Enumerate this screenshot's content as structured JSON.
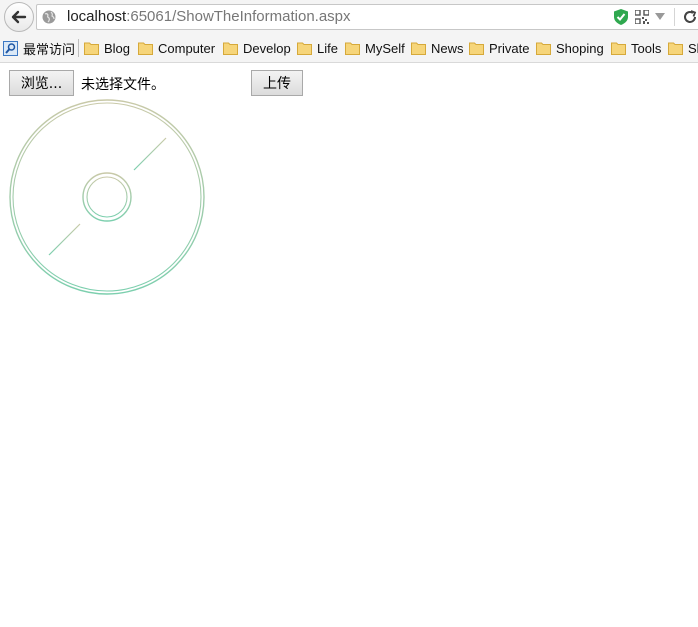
{
  "browser": {
    "url_host": "localhost",
    "url_path": ":65061/ShowTheInformation.aspx",
    "icons": [
      "back-arrow-icon",
      "globe-icon",
      "shield-icon",
      "qr-code-icon",
      "dropdown-icon",
      "reload-icon"
    ],
    "shield_color": "#2fa84f"
  },
  "bookmarks": {
    "most_visited": "最常访问",
    "items": [
      {
        "label": "Blog"
      },
      {
        "label": "Computer"
      },
      {
        "label": "Develop"
      },
      {
        "label": "Life"
      },
      {
        "label": "MySelf"
      },
      {
        "label": "News"
      },
      {
        "label": "Private"
      },
      {
        "label": "Shoping"
      },
      {
        "label": "Tools"
      },
      {
        "label": "Sl"
      }
    ]
  },
  "form": {
    "browse_label": "浏览...",
    "file_status": "未选择文件。",
    "upload_label": "上传"
  },
  "image": {
    "icon": "disc-icon",
    "color_top": "#c9c9a8",
    "color_bottom": "#7ccfae"
  }
}
